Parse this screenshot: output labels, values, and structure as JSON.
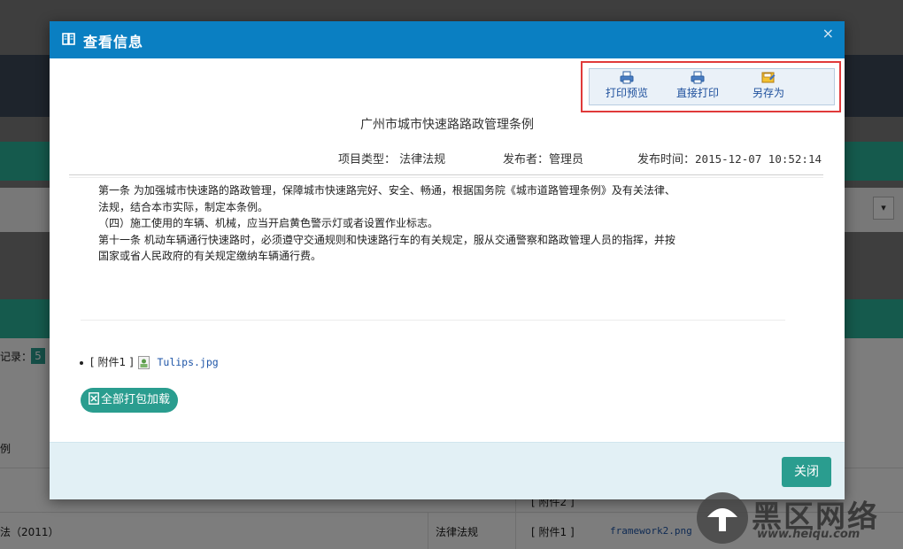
{
  "dialog": {
    "title": "查看信息",
    "close_symbol": "×",
    "toolbar": {
      "print_preview": "打印预览",
      "print_direct": "直接打印",
      "save_as": "另存为"
    },
    "document": {
      "title": "广州市城市快速路路政管理条例",
      "project_type_label": "项目类型：",
      "project_type": "法律法规",
      "publisher_label": "发布者：",
      "publisher": "管理员",
      "publish_time_label": "发布时间：",
      "publish_time": "2015-12-07 10:52:14",
      "paragraphs": [
        "第一条 为加强城市快速路的路政管理，保障城市快速路完好、安全、畅通，根据国务院《城市道路管理条例》及有关法律、",
        "法规，结合本市实际，制定本条例。",
        "（四）施工使用的车辆、机械，应当开启黄色警示灯或者设置作业标志。",
        "第十一条 机动车辆通行快速路时，必须遵守交通规则和快速路行车的有关规定，服从交通警察和路政管理人员的指挥，并按",
        "国家或省人民政府的有关规定缴纳车辆通行费。"
      ]
    },
    "attachments": [
      {
        "label": "[ 附件1 ]",
        "file": "Tulips.jpg"
      }
    ],
    "pack_download": "全部打包加载",
    "close_button": "关闭"
  },
  "background": {
    "records_label": "记录：",
    "records_count": "5",
    "row1_fragment": "例",
    "row2_fragment": "法（2011）",
    "row2_type": "法律法规",
    "row2_attach_label": "[ 附件1 ]",
    "row2_attach_file": "framework2.png",
    "row1_attach_label": "[ 附件2 ]"
  },
  "watermark": {
    "title": "黑区网络",
    "url": "www.heiqu.com"
  },
  "colors": {
    "header_blue": "#0a7fc2",
    "teal": "#2a9d8f",
    "highlight_red": "#e03a3a",
    "footer_bg": "#e2f0f5"
  }
}
